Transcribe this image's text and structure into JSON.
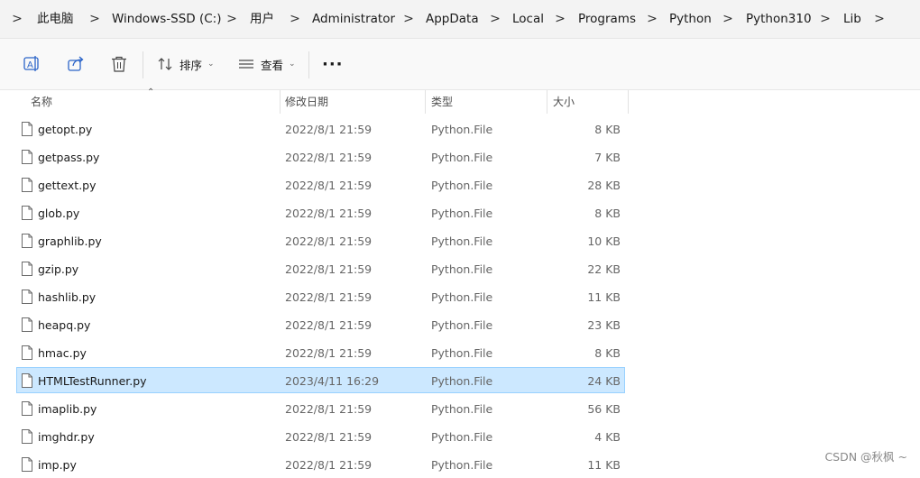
{
  "breadcrumb": {
    "items": [
      "此电脑",
      "Windows-SSD (C:)",
      "用户",
      "Administrator",
      "AppData",
      "Local",
      "Programs",
      "Python",
      "Python310",
      "Lib"
    ]
  },
  "toolbar": {
    "sort_label": "排序",
    "view_label": "查看",
    "more_label": "···"
  },
  "columns": {
    "name": "名称",
    "date": "修改日期",
    "type": "类型",
    "size": "大小"
  },
  "files": [
    {
      "name": "getopt.py",
      "date": "2022/8/1 21:59",
      "type": "Python.File",
      "size": "8 KB"
    },
    {
      "name": "getpass.py",
      "date": "2022/8/1 21:59",
      "type": "Python.File",
      "size": "7 KB"
    },
    {
      "name": "gettext.py",
      "date": "2022/8/1 21:59",
      "type": "Python.File",
      "size": "28 KB"
    },
    {
      "name": "glob.py",
      "date": "2022/8/1 21:59",
      "type": "Python.File",
      "size": "8 KB"
    },
    {
      "name": "graphlib.py",
      "date": "2022/8/1 21:59",
      "type": "Python.File",
      "size": "10 KB"
    },
    {
      "name": "gzip.py",
      "date": "2022/8/1 21:59",
      "type": "Python.File",
      "size": "22 KB"
    },
    {
      "name": "hashlib.py",
      "date": "2022/8/1 21:59",
      "type": "Python.File",
      "size": "11 KB"
    },
    {
      "name": "heapq.py",
      "date": "2022/8/1 21:59",
      "type": "Python.File",
      "size": "23 KB"
    },
    {
      "name": "hmac.py",
      "date": "2022/8/1 21:59",
      "type": "Python.File",
      "size": "8 KB"
    },
    {
      "name": "HTMLTestRunner.py",
      "date": "2023/4/11 16:29",
      "type": "Python.File",
      "size": "24 KB",
      "selected": true
    },
    {
      "name": "imaplib.py",
      "date": "2022/8/1 21:59",
      "type": "Python.File",
      "size": "56 KB"
    },
    {
      "name": "imghdr.py",
      "date": "2022/8/1 21:59",
      "type": "Python.File",
      "size": "4 KB"
    },
    {
      "name": "imp.py",
      "date": "2022/8/1 21:59",
      "type": "Python.File",
      "size": "11 KB"
    }
  ],
  "watermark": "CSDN @秋枫 ~"
}
